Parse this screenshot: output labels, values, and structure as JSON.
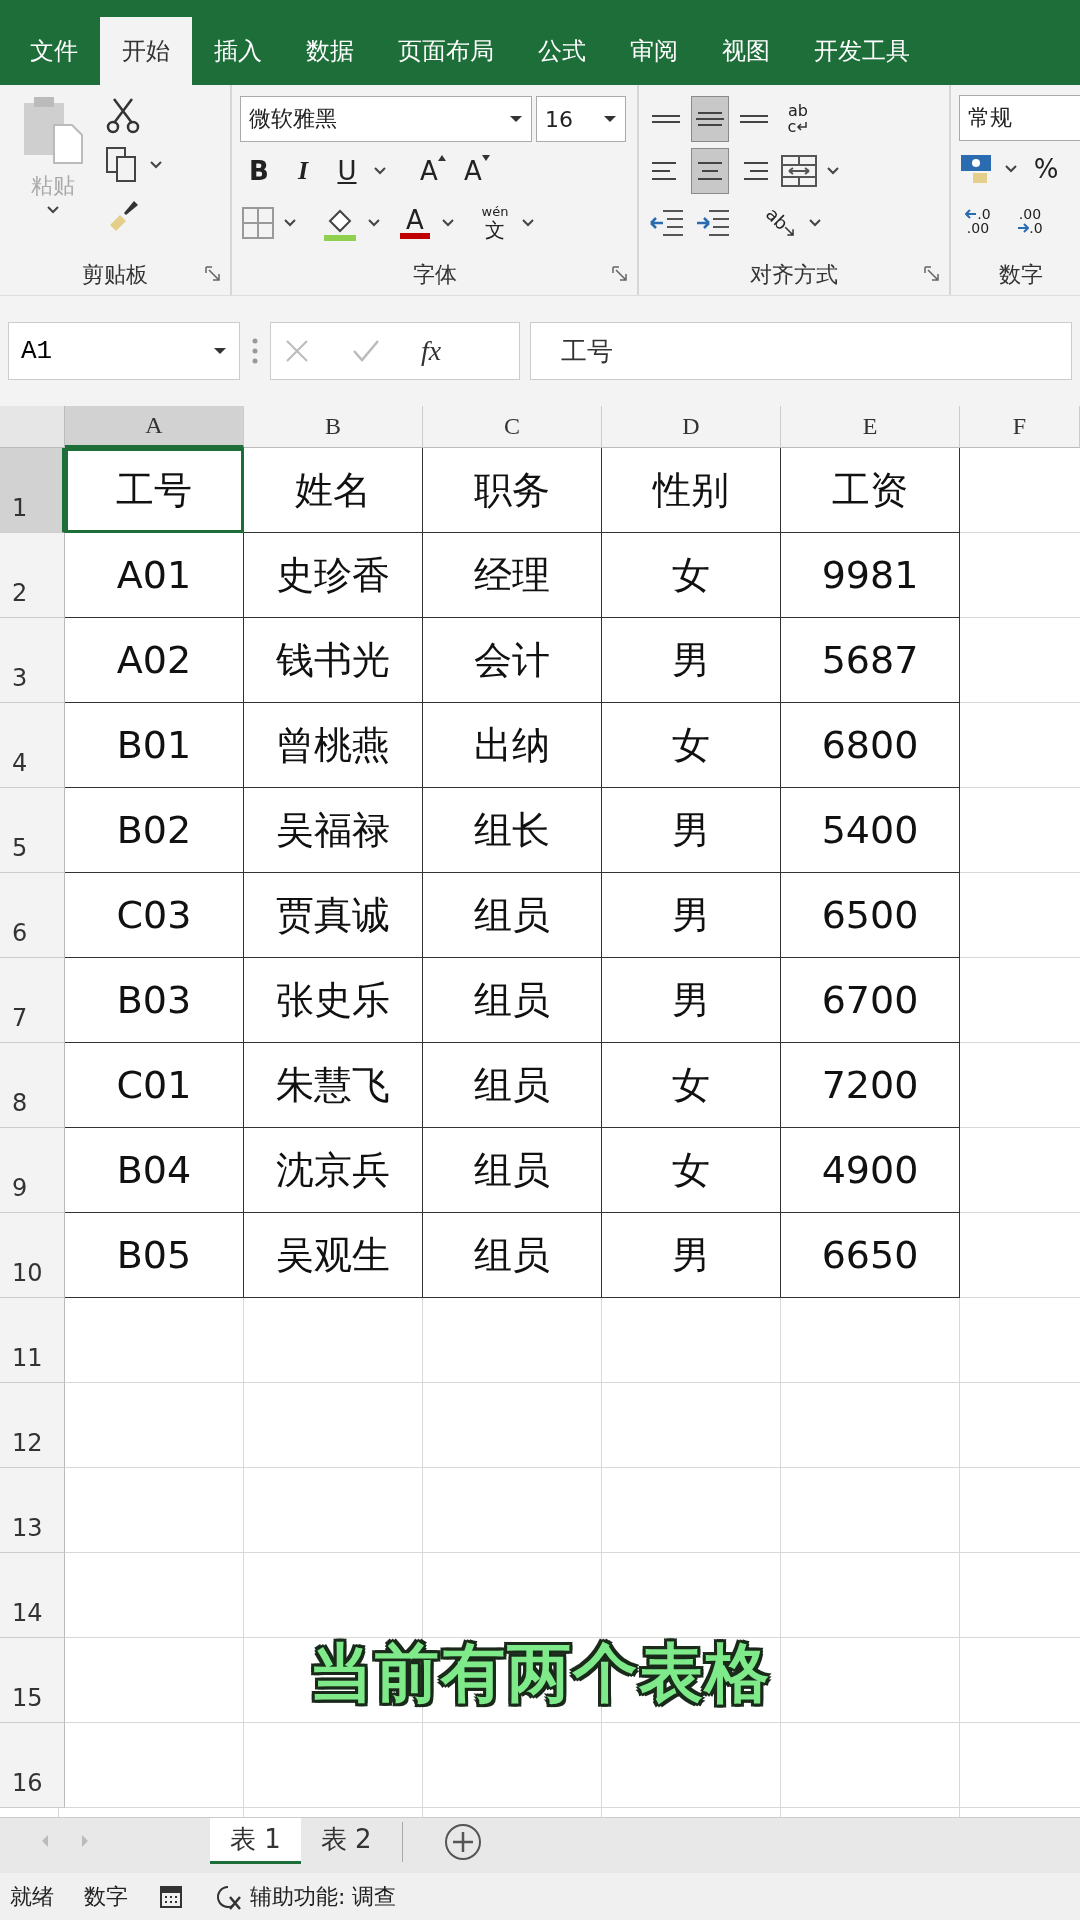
{
  "ribbon_tabs": [
    {
      "label": "文件",
      "selected": false
    },
    {
      "label": "开始",
      "selected": true
    },
    {
      "label": "插入",
      "selected": false
    },
    {
      "label": "数据",
      "selected": false
    },
    {
      "label": "页面布局",
      "selected": false
    },
    {
      "label": "公式",
      "selected": false
    },
    {
      "label": "审阅",
      "selected": false
    },
    {
      "label": "视图",
      "selected": false
    },
    {
      "label": "开发工具",
      "selected": false
    }
  ],
  "clipboard": {
    "paste": {
      "label": "粘贴",
      "disabled": true
    },
    "group": "剪贴板"
  },
  "font": {
    "name": "微软雅黑",
    "size": "16",
    "bold": "B",
    "italic": "I",
    "underline": "U",
    "grow": "A",
    "shrink": "A",
    "color_letter": "A",
    "phonetic_top": "wén",
    "phonetic": "文",
    "group": "字体"
  },
  "alignment": {
    "vertical": [
      {
        "kind": "top",
        "selected": false
      },
      {
        "kind": "middle",
        "selected": true
      },
      {
        "kind": "bottom",
        "selected": false
      }
    ],
    "horizontal": [
      {
        "kind": "left",
        "selected": false
      },
      {
        "kind": "center",
        "selected": true
      },
      {
        "kind": "right",
        "selected": false
      }
    ],
    "wrap_top": "ab",
    "wrap_bottom": "c",
    "orientation": "ab",
    "group": "对齐方式"
  },
  "number": {
    "format": "常规",
    "percent": "%",
    "inc_top": ".0",
    "inc_bottom": ".00",
    "dec_top": ".00",
    "dec_bottom": ".0",
    "group": "数字"
  },
  "formula_bar": {
    "name_box": "A1",
    "fx": "fx",
    "content": "工号"
  },
  "columns": [
    {
      "label": "A",
      "selected": true
    },
    {
      "label": "B",
      "selected": false
    },
    {
      "label": "C",
      "selected": false
    },
    {
      "label": "D",
      "selected": false
    },
    {
      "label": "E",
      "selected": false
    },
    {
      "label": "F",
      "selected": false
    }
  ],
  "rows": [
    {
      "number": "1",
      "selected": true,
      "cells": [
        "工号",
        "姓名",
        "职务",
        "性别",
        "工资"
      ]
    },
    {
      "number": "2",
      "selected": false,
      "cells": [
        "A01",
        "史珍香",
        "经理",
        "女",
        "9981"
      ]
    },
    {
      "number": "3",
      "selected": false,
      "cells": [
        "A02",
        "钱书光",
        "会计",
        "男",
        "5687"
      ]
    },
    {
      "number": "4",
      "selected": false,
      "cells": [
        "B01",
        "曾桃燕",
        "出纳",
        "女",
        "6800"
      ]
    },
    {
      "number": "5",
      "selected": false,
      "cells": [
        "B02",
        "吴福禄",
        "组长",
        "男",
        "5400"
      ]
    },
    {
      "number": "6",
      "selected": false,
      "cells": [
        "C03",
        "贾真诚",
        "组员",
        "男",
        "6500"
      ]
    },
    {
      "number": "7",
      "selected": false,
      "cells": [
        "B03",
        "张史乐",
        "组员",
        "男",
        "6700"
      ]
    },
    {
      "number": "8",
      "selected": false,
      "cells": [
        "C01",
        "朱慧飞",
        "组员",
        "女",
        "7200"
      ]
    },
    {
      "number": "9",
      "selected": false,
      "cells": [
        "B04",
        "沈京兵",
        "组员",
        "女",
        "4900"
      ]
    },
    {
      "number": "10",
      "selected": false,
      "cells": [
        "B05",
        "吴观生",
        "组员",
        "男",
        "6650"
      ]
    },
    {
      "number": "11",
      "selected": false,
      "cells": []
    },
    {
      "number": "12",
      "selected": false,
      "cells": []
    },
    {
      "number": "13",
      "selected": false,
      "cells": []
    },
    {
      "number": "14",
      "selected": false,
      "cells": []
    },
    {
      "number": "15",
      "selected": false,
      "cells": []
    },
    {
      "number": "16",
      "selected": false,
      "cells": []
    }
  ],
  "caption": "当前有两个表格",
  "sheet_tabs": [
    {
      "label": "表 1",
      "selected": true
    },
    {
      "label": "表 2",
      "selected": false
    }
  ],
  "status_bar": {
    "ready": "就绪",
    "mode": "数字",
    "accessibility": "辅助功能: 调查"
  }
}
